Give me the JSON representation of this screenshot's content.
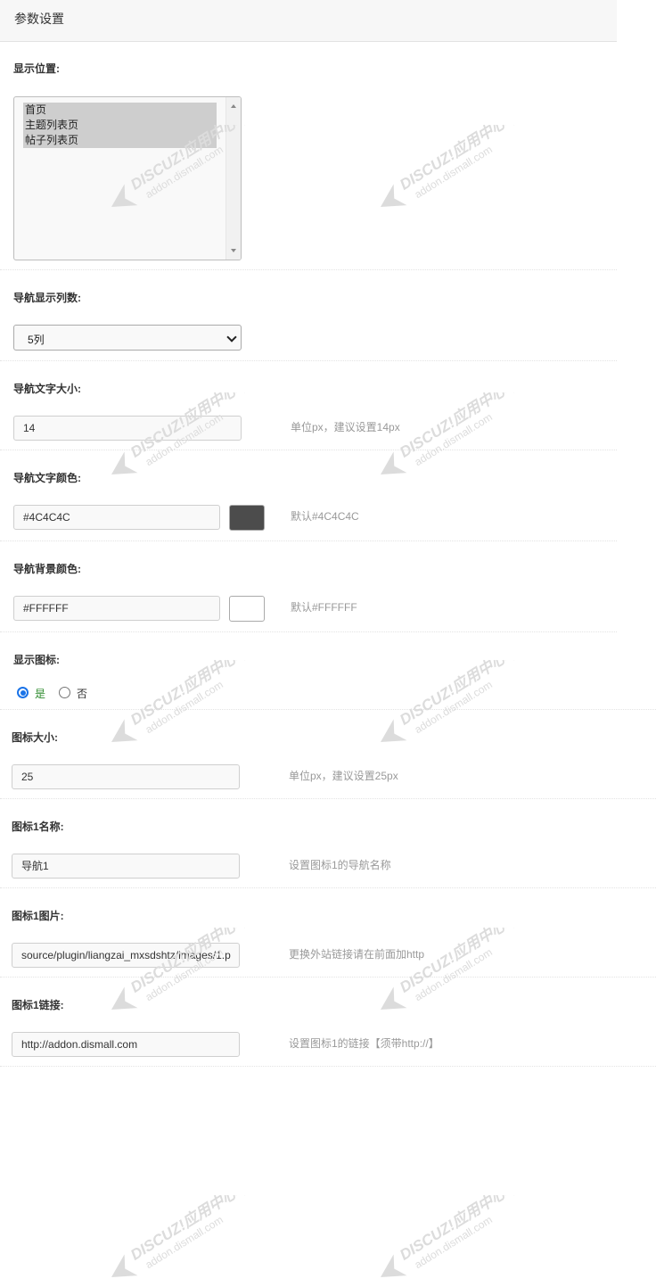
{
  "header": {
    "title": "参数设置"
  },
  "display_position": {
    "label": "显示位置:",
    "options": [
      "首页",
      "主题列表页",
      "帖子列表页"
    ]
  },
  "nav_columns": {
    "label": "导航显示列数:",
    "value": "5列"
  },
  "nav_font_size": {
    "label": "导航文字大小:",
    "value": "14",
    "hint": "单位px，建议设置14px"
  },
  "nav_text_color": {
    "label": "导航文字颜色:",
    "value": "#4C4C4C",
    "swatch_color": "#4C4C4C",
    "hint": "默认#4C4C4C"
  },
  "nav_bg_color": {
    "label": "导航背景颜色:",
    "value": "#FFFFFF",
    "swatch_color": "#FFFFFF",
    "hint": "默认#FFFFFF"
  },
  "show_icon": {
    "label": "显示图标:",
    "yes_label": "是",
    "no_label": "否",
    "selected": "yes",
    "yes_color": "#2e8b2e"
  },
  "icon_size": {
    "label": "图标大小:",
    "value": "25",
    "hint": "单位px，建议设置25px"
  },
  "icon1_name": {
    "label": "图标1名称:",
    "value": "导航1",
    "hint": "设置图标1的导航名称"
  },
  "icon1_image": {
    "label": "图标1图片:",
    "value": "source/plugin/liangzai_mxsdshtz/images/1.p",
    "hint": "更换外站链接请在前面加http"
  },
  "icon1_link": {
    "label": "图标1链接:",
    "value": "http://addon.dismall.com",
    "hint": "设置图标1的链接【须带http://】"
  },
  "watermark": {
    "line1": "DISCUZ!应用中心 | 贰道",
    "line2": "addon.dismall.com"
  }
}
